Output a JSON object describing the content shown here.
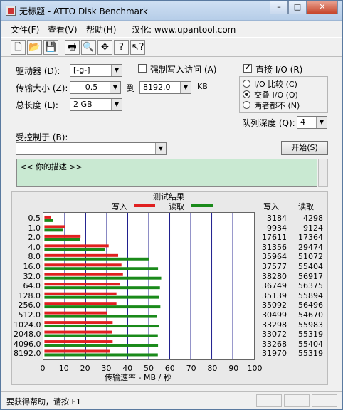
{
  "window": {
    "title": "无标题 - ATTO Disk Benchmark"
  },
  "titlebar": {
    "minimize": "–",
    "maximize": "□",
    "close": "✕"
  },
  "menu": [
    "文件(F)",
    "查看(V)",
    "帮助(H)",
    "汉化: www.upantool.com"
  ],
  "toolbar": {
    "icons": [
      "new-file-icon",
      "open-folder-icon",
      "save-icon",
      "print-icon",
      "print-preview-icon",
      "move-icon",
      "help-icon",
      "context-help-icon"
    ]
  },
  "settings": {
    "drive_label": "驱动器 (D):",
    "drive_value": "[-g-]",
    "transfer_label": "传输大小 (Z):",
    "transfer_from": "0.5",
    "transfer_to_label": "到",
    "transfer_to": "8192.0",
    "transfer_unit": "KB",
    "length_label": "总长度 (L):",
    "length_value": "2 GB",
    "force_write_label": "强制写入访问 (A)",
    "direct_io_label": "直接 I/O (R)",
    "io_compare_label": "I/O 比较 (C)",
    "overlap_io_label": "交叠 I/O (O)",
    "neither_label": "两者都不 (N)",
    "queue_label": "队列深度 (Q):",
    "queue_value": "4",
    "controlled_label": "受控制于 (B):",
    "controlled_value": "",
    "start_button": "开始(S)",
    "description": "<<   你的描述    >>"
  },
  "results": {
    "title": "测试结果",
    "legend_write": "写入",
    "legend_read": "读取",
    "col_write": "写入",
    "col_read": "读取",
    "x_title": "传输速率 - MB / 秒"
  },
  "chart_data": {
    "type": "bar",
    "orientation": "horizontal",
    "title": "测试结果",
    "xlabel": "传输速率 - MB / 秒",
    "xlim": [
      0,
      100
    ],
    "xticks": [
      0,
      10,
      20,
      30,
      40,
      50,
      60,
      70,
      80,
      90,
      100
    ],
    "categories": [
      "0.5",
      "1.0",
      "2.0",
      "4.0",
      "8.0",
      "16.0",
      "32.0",
      "64.0",
      "128.0",
      "256.0",
      "512.0",
      "1024.0",
      "2048.0",
      "4096.0",
      "8192.0"
    ],
    "series": [
      {
        "name": "写入",
        "color": "#e02020",
        "values": [
          3.1,
          9.7,
          17.2,
          30.6,
          35.1,
          36.7,
          37.4,
          35.9,
          34.3,
          34.3,
          29.8,
          32.5,
          32.3,
          32.5,
          31.2
        ]
      },
      {
        "name": "读取",
        "color": "#1a8a1a",
        "values": [
          4.2,
          8.9,
          17.0,
          28.8,
          49.9,
          54.1,
          55.6,
          55.0,
          54.6,
          55.2,
          53.4,
          54.7,
          54.0,
          54.1,
          54.0
        ]
      }
    ],
    "raw_write": [
      "3184",
      "9934",
      "17611",
      "31356",
      "35964",
      "37577",
      "38280",
      "36749",
      "35139",
      "35092",
      "30499",
      "33298",
      "33072",
      "33268",
      "31970"
    ],
    "raw_read": [
      "4298",
      "9124",
      "17364",
      "29474",
      "51072",
      "55404",
      "56917",
      "56375",
      "55894",
      "56496",
      "54670",
      "55983",
      "55319",
      "55404",
      "55319"
    ]
  },
  "status": {
    "text": "要获得帮助，请按 F1"
  },
  "colors": {
    "write": "#e02020",
    "read": "#1a8a1a",
    "description_bg": "#c9e9d2"
  }
}
